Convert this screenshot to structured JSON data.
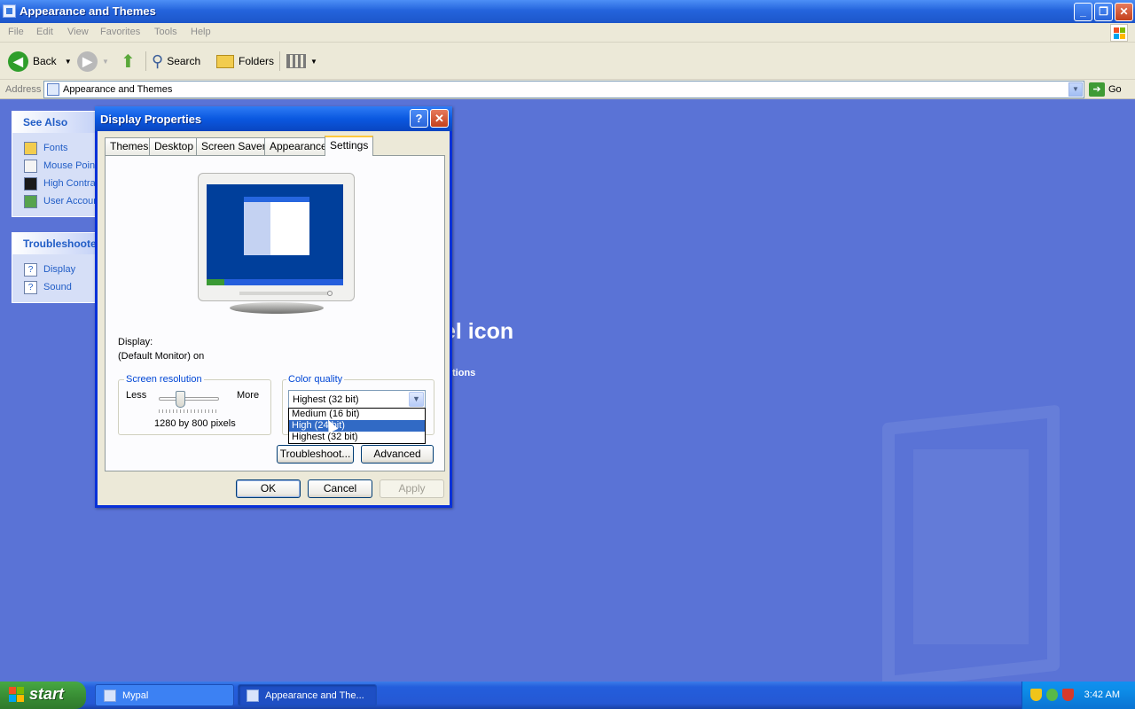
{
  "window": {
    "title": "Appearance and Themes"
  },
  "menu": [
    "File",
    "Edit",
    "View",
    "Favorites",
    "Tools",
    "Help"
  ],
  "toolbar": {
    "back": "Back",
    "search": "Search",
    "folders": "Folders"
  },
  "address": {
    "label": "Address",
    "value": "Appearance and Themes",
    "go": "Go"
  },
  "see_also": {
    "title": "See Also",
    "items": [
      "Fonts",
      "Mouse Pointers",
      "High Contrast",
      "User Account Picture"
    ]
  },
  "troubleshooters": {
    "title": "Troubleshooters",
    "items": [
      "Display",
      "Sound"
    ]
  },
  "background_text": {
    "heading_fragment": "el icon",
    "line_fragment": "tions"
  },
  "dialog": {
    "title": "Display Properties",
    "tabs": [
      "Themes",
      "Desktop",
      "Screen Saver",
      "Appearance",
      "Settings"
    ],
    "active_tab": "Settings",
    "display_label": "Display:",
    "display_value": "(Default Monitor) on",
    "resolution": {
      "label": "Screen resolution",
      "less": "Less",
      "more": "More",
      "value": "1280 by 800 pixels",
      "slider_position": 0.33
    },
    "color_quality": {
      "label": "Color quality",
      "selected": "Highest (32 bit)",
      "options": [
        "Medium (16 bit)",
        "High (24 bit)",
        "Highest (32 bit)"
      ],
      "highlighted": "High (24 bit)"
    },
    "buttons": {
      "troubleshoot": "Troubleshoot...",
      "advanced": "Advanced",
      "ok": "OK",
      "cancel": "Cancel",
      "apply": "Apply"
    }
  },
  "taskbar": {
    "start": "start",
    "items": [
      "Mypal",
      "Appearance and The..."
    ],
    "clock": "3:42 AM"
  },
  "colors": {
    "xp_blue": "#245edc",
    "start_green": "#378a33",
    "highlight": "#316ac5"
  }
}
